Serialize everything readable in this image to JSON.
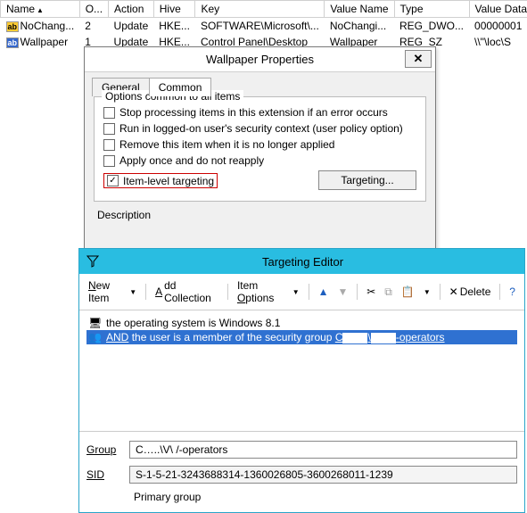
{
  "grid": {
    "columns": [
      "Name",
      "O...",
      "Action",
      "Hive",
      "Key",
      "Value Name",
      "Type",
      "Value Data"
    ],
    "rows": [
      {
        "icon": "ab",
        "name": "NoChang...",
        "o": "2",
        "action": "Update",
        "hive": "HKE...",
        "key": "SOFTWARE\\Microsoft\\...",
        "vname": "NoChangi...",
        "type": "REG_DWO...",
        "vdata": "00000001"
      },
      {
        "icon": "ab2",
        "name": "Wallpaper",
        "o": "1",
        "action": "Update",
        "hive": "HKE...",
        "key": "Control Panel\\Desktop",
        "vname": "Wallpaper",
        "type": "REG_SZ",
        "vdata": "\\\\\"\\loc\\S"
      }
    ]
  },
  "dialog": {
    "title": "Wallpaper Properties",
    "tabs": {
      "general": "General",
      "common": "Common"
    },
    "group_legend": "Options common to all items",
    "checks": {
      "stop": "Stop processing items in this extension if an error occurs",
      "runas": "Run in logged-on user's security context (user policy option)",
      "remove": "Remove this item when it is no longer applied",
      "once": "Apply once and do not reapply",
      "target": "Item-level targeting"
    },
    "targeting_btn": "Targeting...",
    "description_label": "Description"
  },
  "editor": {
    "title": "Targeting Editor",
    "toolbar": {
      "new_item": "New Item",
      "add_collection": "Add Collection",
      "item_options": "Item Options",
      "delete": "Delete"
    },
    "rules": {
      "line1": "the operating system is Windows 8.1",
      "line2_prefix": "AND",
      "line2_text": "the user is a member of the security group",
      "line2_mid": "C",
      "line2_sep": "\\",
      "line2_suffix": "-operators"
    },
    "fields": {
      "group_label": "Group",
      "group_value": "C…..\\V\\   /-operators",
      "sid_label": "SID",
      "sid_value": "S-1-5-21-3243688314-1360026805-3600268011-1239",
      "primary_label": "Primary group"
    }
  }
}
